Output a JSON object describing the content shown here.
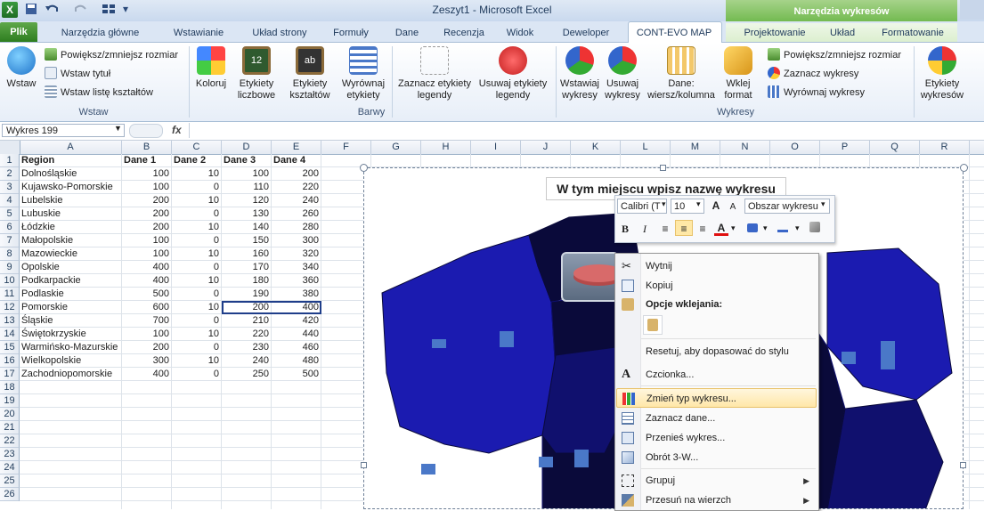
{
  "app": {
    "window_title": "Zeszyt1 - Microsoft Excel",
    "context_tools_title": "Narzędzia wykresów"
  },
  "tabs": {
    "file": "Plik",
    "items": [
      "Narzędzia główne",
      "Wstawianie",
      "Układ strony",
      "Formuły",
      "Dane",
      "Recenzja",
      "Widok",
      "Deweloper",
      "CONT-EVO MAP",
      "Projektowanie",
      "Układ",
      "Formatowanie"
    ],
    "active": "CONT-EVO MAP"
  },
  "ribbon": {
    "group_wstaw": {
      "label": "Wstaw",
      "big_button": "Wstaw",
      "resize_label": "Powiększ/zmniejsz rozmiar",
      "insert_title_label": "Wstaw tytuł",
      "insert_list_label": "Wstaw listę kształtów"
    },
    "group_barwy": {
      "label": "Barwy",
      "koloruj": "Koloruj",
      "etykiety_liczbowe": "Etykiety liczbowe",
      "etykiety_ksztaltow": "Etykiety kształtów",
      "wyrownaj_etykiety": "Wyrównaj etykiety",
      "zaznacz_etykiety": "Zaznacz etykiety legendy",
      "usuwaj_etykiety": "Usuwaj etykiety legendy"
    },
    "group_wykresy": {
      "label": "Wykresy",
      "wstawiaj": "Wstawiaj wykresy",
      "usuwaj": "Usuwaj wykresy",
      "dane": "Dane: wiersz/kolumna",
      "wklej": "Wklej format",
      "resize_label": "Powiększ/zmniejsz rozmiar",
      "select_label": "Zaznacz wykresy",
      "align_label": "Wyrównaj wykresy",
      "etykiety_wykresow": "Etykiety wykresów"
    }
  },
  "formula_bar": {
    "name_box": "Wykres 199",
    "fx": "fx",
    "value": ""
  },
  "sheet": {
    "columns": [
      "A",
      "B",
      "C",
      "D",
      "E",
      "F",
      "G",
      "H",
      "I",
      "J",
      "K",
      "L",
      "M",
      "N",
      "O",
      "P",
      "Q",
      "R"
    ],
    "rows": [
      "1",
      "2",
      "3",
      "4",
      "5",
      "6",
      "7",
      "8",
      "9",
      "10",
      "11",
      "12",
      "13",
      "14",
      "15",
      "16",
      "17",
      "18",
      "19",
      "20",
      "21",
      "22",
      "23",
      "24",
      "25",
      "26"
    ],
    "headers": [
      "Region",
      "Dane 1",
      "Dane 2",
      "Dane 3",
      "Dane 4"
    ],
    "data": [
      [
        "Dolnośląskie",
        "100",
        "10",
        "100",
        "200"
      ],
      [
        "Kujawsko-Pomorskie",
        "100",
        "0",
        "110",
        "220"
      ],
      [
        "Lubelskie",
        "200",
        "10",
        "120",
        "240"
      ],
      [
        "Lubuskie",
        "200",
        "0",
        "130",
        "260"
      ],
      [
        "Łódzkie",
        "200",
        "10",
        "140",
        "280"
      ],
      [
        "Małopolskie",
        "100",
        "0",
        "150",
        "300"
      ],
      [
        "Mazowieckie",
        "100",
        "10",
        "160",
        "320"
      ],
      [
        "Opolskie",
        "400",
        "0",
        "170",
        "340"
      ],
      [
        "Podkarpackie",
        "400",
        "10",
        "180",
        "360"
      ],
      [
        "Podlaskie",
        "500",
        "0",
        "190",
        "380"
      ],
      [
        "Pomorskie",
        "600",
        "10",
        "200",
        "400"
      ],
      [
        "Śląskie",
        "700",
        "0",
        "210",
        "420"
      ],
      [
        "Świętokrzyskie",
        "100",
        "10",
        "220",
        "440"
      ],
      [
        "Warmińsko-Mazurskie",
        "200",
        "0",
        "230",
        "460"
      ],
      [
        "Wielkopolskie",
        "300",
        "10",
        "240",
        "480"
      ],
      [
        "Zachodniopomorskie",
        "400",
        "0",
        "250",
        "500"
      ]
    ]
  },
  "chart": {
    "title": "W tym miejscu wpisz nazwę wykresu",
    "map_colors": {
      "dark": "#0a0a3a",
      "mid": "#10106e",
      "bright": "#1b1bb0",
      "bar": "#4a78c8"
    }
  },
  "mini_toolbar": {
    "font": "Calibri (T",
    "size": "10",
    "element": "Obszar wykresu",
    "grow": "A",
    "shrink": "A",
    "bold": "B",
    "italic": "I",
    "font_color_letter": "A"
  },
  "context_menu": {
    "items": [
      {
        "label": "Wytnij"
      },
      {
        "label": "Kopiuj"
      },
      {
        "label": "Opcje wklejania:"
      },
      {
        "label": "Resetuj, aby dopasować do stylu"
      },
      {
        "label": "Czcionka..."
      },
      {
        "label": "Zmień typ wykresu..."
      },
      {
        "label": "Zaznacz dane..."
      },
      {
        "label": "Przenieś wykres..."
      },
      {
        "label": "Obrót 3-W..."
      },
      {
        "label": "Grupuj"
      },
      {
        "label": "Przesuń na wierzch"
      }
    ]
  }
}
